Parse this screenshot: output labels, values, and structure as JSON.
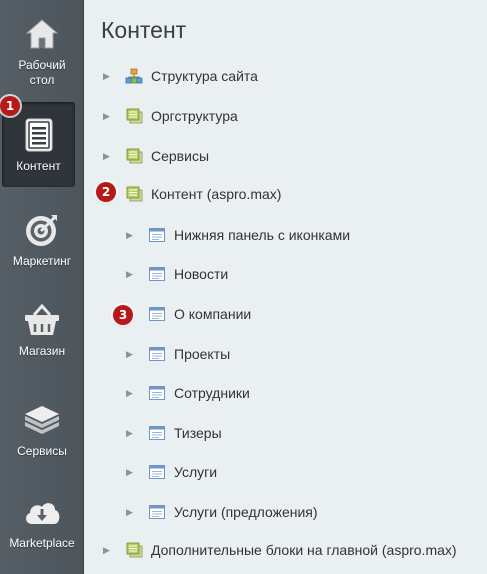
{
  "sidebar": {
    "items": [
      {
        "label": "Рабочий стол",
        "icon": "home-icon"
      },
      {
        "label": "Контент",
        "icon": "document-icon"
      },
      {
        "label": "Маркетинг",
        "icon": "target-icon"
      },
      {
        "label": "Магазин",
        "icon": "basket-icon"
      },
      {
        "label": "Сервисы",
        "icon": "layers-icon"
      },
      {
        "label": "Marketplace",
        "icon": "cloud-download-icon"
      }
    ]
  },
  "badges": [
    "1",
    "2",
    "3"
  ],
  "page_title": "Контент",
  "tree": [
    {
      "label": "Структура сайта",
      "icon": "sitemap-icon",
      "expandable": true
    },
    {
      "label": "Оргструктура",
      "icon": "iblock-icon",
      "expandable": true
    },
    {
      "label": "Сервисы",
      "icon": "iblock-icon",
      "expandable": true
    },
    {
      "label": "Контент (aspro.max)",
      "icon": "iblock-icon",
      "expandable": false
    },
    {
      "label": "Нижняя панель с иконками",
      "icon": "list-icon",
      "expandable": true
    },
    {
      "label": "Новости",
      "icon": "list-icon",
      "expandable": true
    },
    {
      "label": "О компании",
      "icon": "list-icon",
      "expandable": false
    },
    {
      "label": "Проекты",
      "icon": "list-icon",
      "expandable": true
    },
    {
      "label": "Сотрудники",
      "icon": "list-icon",
      "expandable": true
    },
    {
      "label": "Тизеры",
      "icon": "list-icon",
      "expandable": true
    },
    {
      "label": "Услуги",
      "icon": "list-icon",
      "expandable": true
    },
    {
      "label": "Услуги (предложения)",
      "icon": "list-icon",
      "expandable": true
    },
    {
      "label": "Дополнительные блоки на главной (aspro.max)",
      "icon": "iblock-icon",
      "expandable": true
    }
  ],
  "colors": {
    "sidebar_bg": "#525a61",
    "sidebar_active": "#2f353b",
    "badge": "#b51a1a",
    "main_bg": "#eaeff2"
  }
}
